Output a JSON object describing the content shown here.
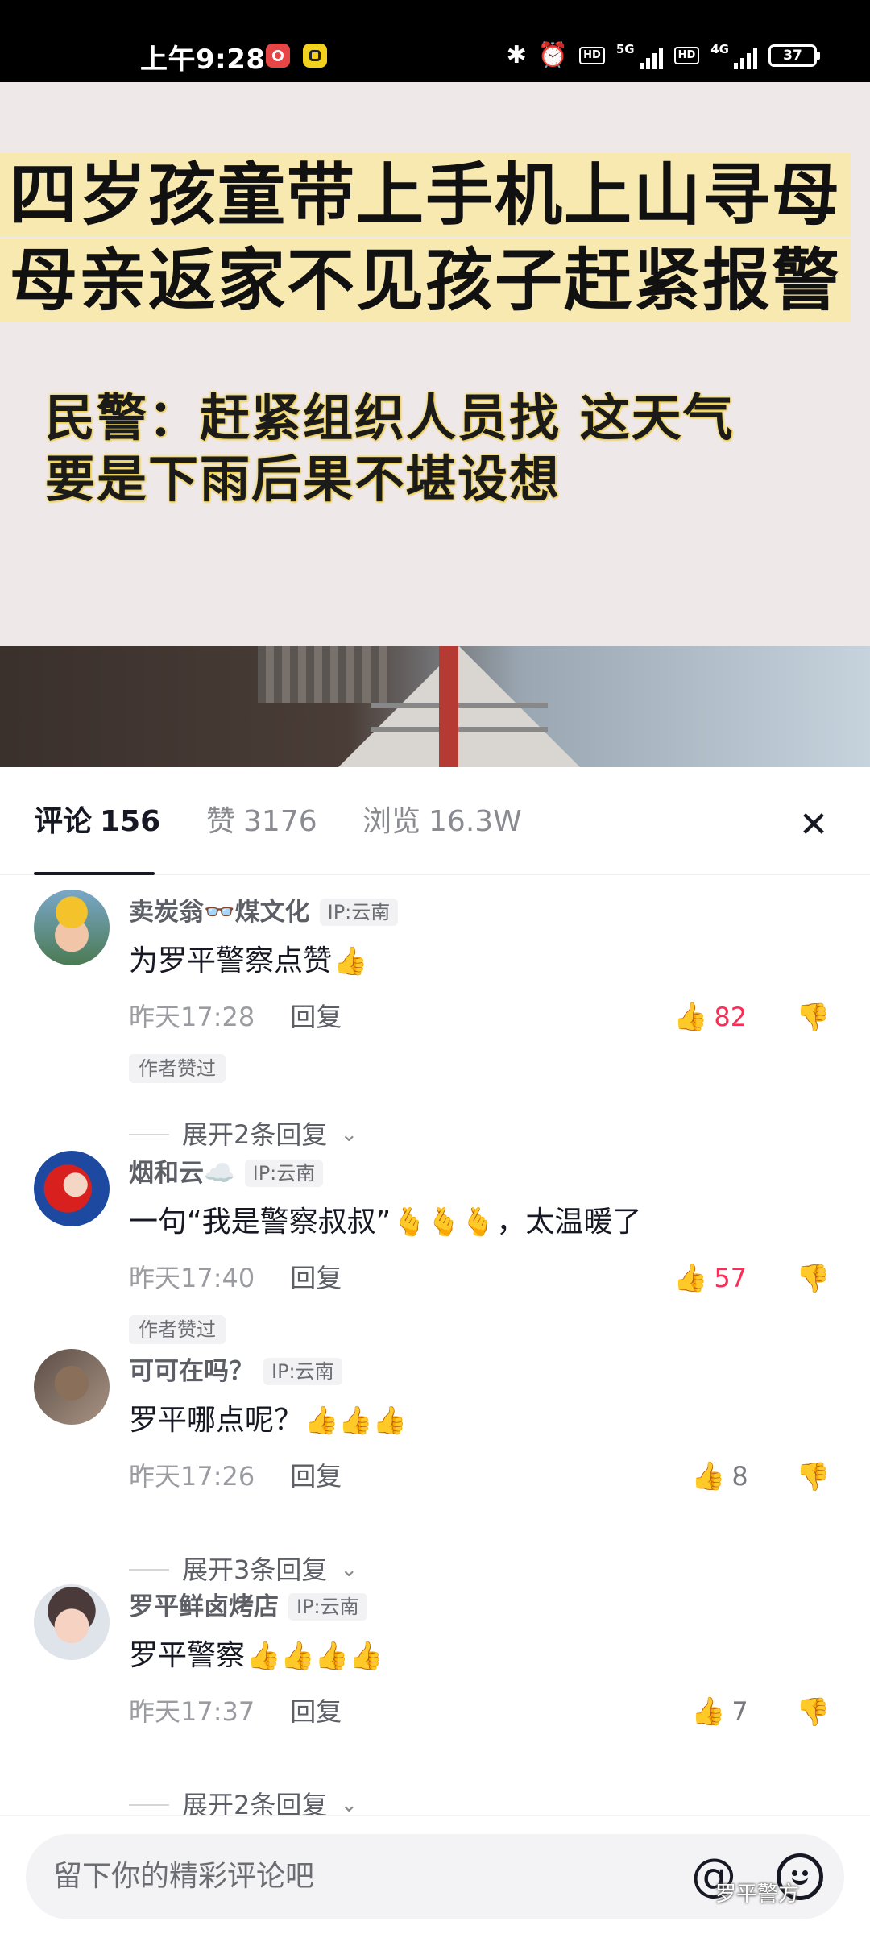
{
  "status_bar": {
    "time": "上午9:28",
    "hd1": "HD",
    "net1": "5G",
    "hd2": "HD",
    "net2": "4G",
    "battery": "37"
  },
  "video": {
    "title_line1": "四岁孩童带上手机上山寻母",
    "title_line2": "母亲返家不见孩子赶紧报警",
    "subtitle_line1": "民警：赶紧组织人员找 这天气",
    "subtitle_line2": "要是下雨后果不堪设想"
  },
  "tabs": {
    "comments_label": "评论",
    "comments_count": "156",
    "likes_label": "赞",
    "likes_count": "3176",
    "views_label": "浏览",
    "views_count": "16.3W"
  },
  "comments": [
    {
      "name": "卖炭翁👓煤文化",
      "ip": "IP:云南",
      "text": "为罗平警察点赞",
      "emojis": "👍",
      "time": "昨天17:28",
      "reply": "回复",
      "likes": "82",
      "liked": true,
      "author_liked": "作者赞过",
      "expand": "展开2条回复"
    },
    {
      "name": "烟和云☁️",
      "ip": "IP:云南",
      "text": "一句“我是警察叔叔”",
      "emojis": "🫰🫰🫰",
      "text_after": "，太温暖了",
      "time": "昨天17:40",
      "reply": "回复",
      "likes": "57",
      "liked": true,
      "author_liked": "作者赞过"
    },
    {
      "name": "可可在吗？",
      "ip": "IP:云南",
      "text": "罗平哪点呢？",
      "emojis": "👍👍👍",
      "time": "昨天17:26",
      "reply": "回复",
      "likes": "8",
      "liked": false,
      "expand": "展开3条回复"
    },
    {
      "name": "罗平鲜卤烤店",
      "ip": "IP:云南",
      "text": "罗平警察",
      "emojis": "👍👍👍👍",
      "time": "昨天17:37",
      "reply": "回复",
      "likes": "7",
      "liked": false,
      "expand": "展开2条回复"
    }
  ],
  "input": {
    "placeholder": "留下你的精彩评论吧",
    "at": "@"
  },
  "watermark": "罗平警方",
  "colors": {
    "accent_red": "#fe2c55",
    "caption_highlight": "#f8e9b0",
    "text_primary": "#161823"
  }
}
